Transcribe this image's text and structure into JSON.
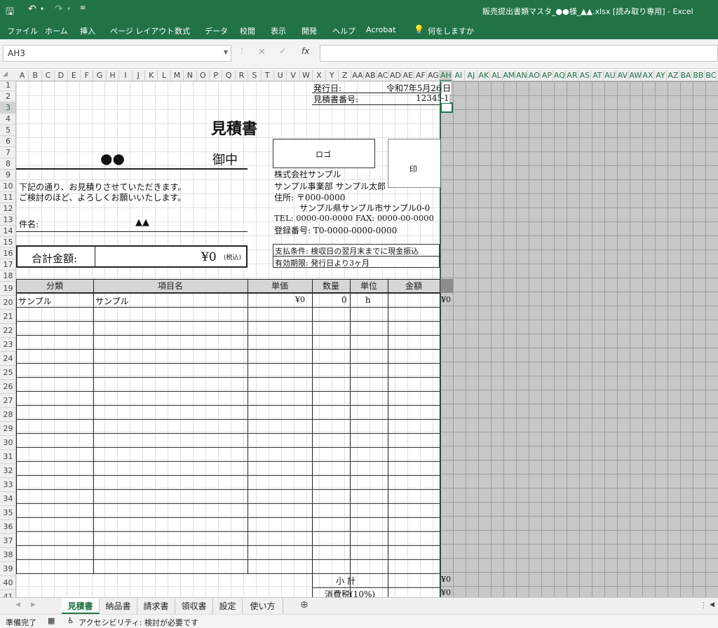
{
  "window": {
    "title": "販売提出書類マスタ_●●様_▲▲.xlsx [読み取り専用] - Excel"
  },
  "ribbon": {
    "tabs": [
      "ファイル",
      "ホーム",
      "挿入",
      "ページ レイアウト",
      "数式",
      "データ",
      "校閲",
      "表示",
      "開発",
      "ヘルプ",
      "Acrobat"
    ],
    "tell_me": "何をしますか"
  },
  "formula_bar": {
    "name_box": "AH3",
    "fx": "fx",
    "value": ""
  },
  "columns": [
    "A",
    "B",
    "C",
    "D",
    "E",
    "F",
    "G",
    "H",
    "I",
    "J",
    "K",
    "L",
    "M",
    "N",
    "O",
    "P",
    "Q",
    "R",
    "S",
    "T",
    "U",
    "V",
    "W",
    "X",
    "Y",
    "Z",
    "AA",
    "AB",
    "AC",
    "AD",
    "AE",
    "AF",
    "AG",
    "AH",
    "AI",
    "AJ",
    "AK",
    "AL",
    "AM",
    "AN",
    "AO",
    "AP",
    "AQ",
    "AR",
    "AS",
    "AT",
    "AU",
    "AV",
    "AW",
    "AX",
    "AY",
    "AZ",
    "BA",
    "BB",
    "BC"
  ],
  "rows": [
    "1",
    "2",
    "3",
    "4",
    "5",
    "6",
    "7",
    "8",
    "9",
    "10",
    "11",
    "12",
    "13",
    "14",
    "15",
    "16",
    "17",
    "18",
    "19",
    "20",
    "21",
    "22",
    "23",
    "24",
    "25",
    "26",
    "27",
    "28",
    "29",
    "30",
    "31",
    "32",
    "33",
    "34",
    "35",
    "36",
    "37",
    "38",
    "39",
    "40",
    "41"
  ],
  "doc": {
    "issue_date_label": "発行日:",
    "issue_date": "令和7年5月26",
    "issue_date_suffix": "日",
    "estimate_no_label": "見積書番号:",
    "estimate_no": "12345",
    "estimate_no_suffix": "-1",
    "title": "見積書",
    "client_name": "●●",
    "honorific": "御中",
    "logo": "ロゴ",
    "seal": "印",
    "greeting1": "下記の通り、お見積りさせていただきます。",
    "greeting2": "ご検討のほど、よろしくお願いいたします。",
    "company": "株式会社サンプル",
    "person": "サンプル事業部 サンプル太郎",
    "address_label": "住所: 〒000-0000",
    "address": "サンプル県サンプル市サンプル0-0",
    "tel_fax": "TEL: 0000-00-0000 FAX: 0000-00-0000",
    "reg_no": "登録番号: T0-0000-0000-0000",
    "subject_label": "件名:",
    "subject": "▲▲",
    "payment_terms": "支払条件: 検収日の翌月末までに現金振込",
    "validity": "有効期限: 発行日より3ヶ月",
    "total_label": "合計金額:",
    "total_value": "¥0",
    "tax_included": "(税込)",
    "table_headers": [
      "分類",
      "項目名",
      "単価",
      "数量",
      "単位",
      "金額"
    ],
    "row1": {
      "category": "サンプル",
      "item": "サンプル",
      "price": "¥0",
      "qty": "0",
      "unit": "h",
      "amount": "¥0"
    },
    "subtotal_label": "小 計",
    "subtotal_value": "¥0",
    "tax_label": "消費税(10%)",
    "tax_value": "¥0"
  },
  "sheet_tabs": [
    "見積書",
    "納品書",
    "請求書",
    "領収書",
    "設定",
    "使い方"
  ],
  "status": {
    "ready": "準備完了",
    "accessibility": "アクセシビリティ: 検討が必要です"
  }
}
